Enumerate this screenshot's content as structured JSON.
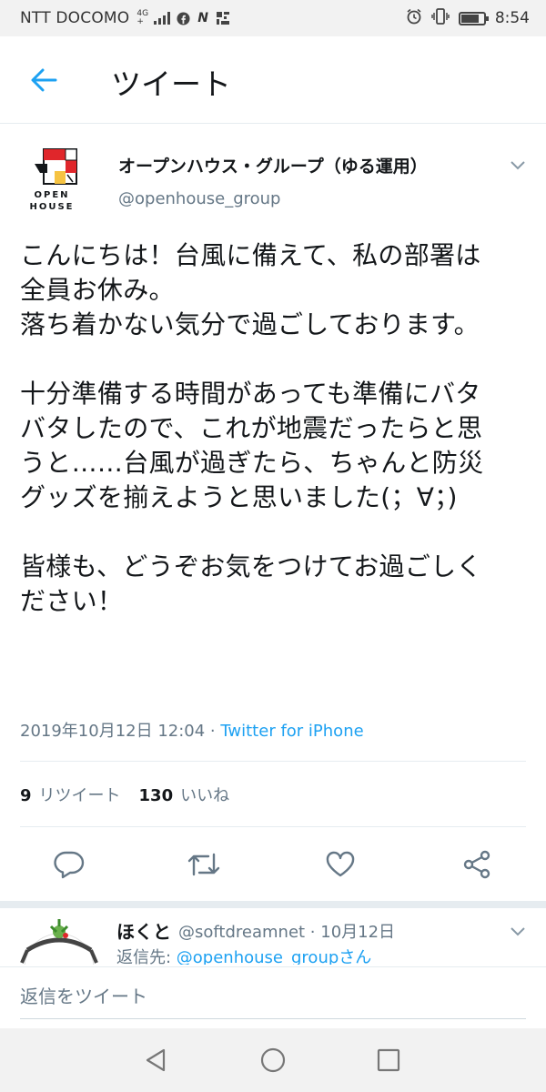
{
  "status_bar": {
    "carrier": "NTT DOCOMO",
    "network_top": "4G",
    "network_bottom": "+",
    "time": "8:54",
    "battery_level": 0.8
  },
  "header": {
    "title": "ツイート",
    "back_icon": "arrow-left-icon"
  },
  "tweet": {
    "display_name": "オープンハウス・グループ（ゆる運用）",
    "handle": "@openhouse_group",
    "avatar_text_line1": "OPEN",
    "avatar_text_line2": "HOUSE",
    "body": "こんにちは！台風に備えて、私の部署は\n全員お休み。\n落ち着かない気分で過ごしております。\n\n十分準備する時間があっても準備にバタ\nバタしたので、これが地震だったらと思\nうと……台風が過ぎたら、ちゃんと防災\nグッズを揃えようと思いました(；∀；)\n\n皆様も、どうぞお気をつけてお過ごしく\nださい！",
    "timestamp": "2019年10月12日 12:04 · ",
    "source": "Twitter for iPhone",
    "retweet_count": "9",
    "retweet_label": "リツイート",
    "like_count": "130",
    "like_label": "いいね"
  },
  "actions": {
    "reply": "reply-icon",
    "retweet": "retweet-icon",
    "like": "heart-icon",
    "share": "share-icon"
  },
  "reply": {
    "name": "ほくと",
    "handle_date": "@softdreamnet · 10月12日",
    "reply_to_prefix": "返信先: ",
    "reply_to_user": "@openhouse_groupさん"
  },
  "compose": {
    "placeholder": "返信をツイート"
  },
  "colors": {
    "accent": "#1da1f2",
    "text": "#14171a",
    "muted": "#657786"
  }
}
